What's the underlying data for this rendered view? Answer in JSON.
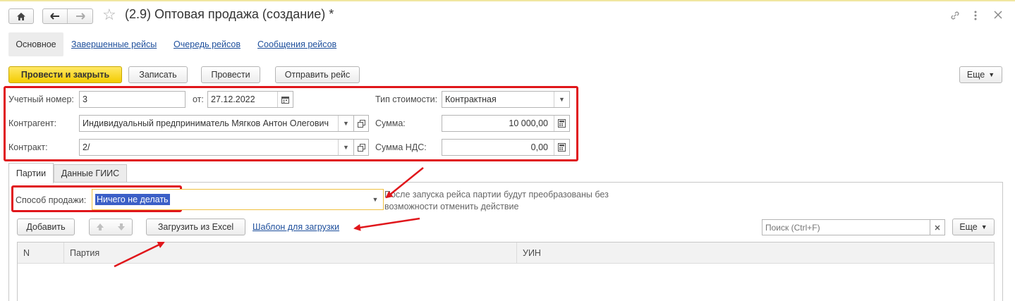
{
  "window": {
    "title": "(2.9) Оптовая продажа (создание) *",
    "icons": [
      "home-icon",
      "back-arrow-icon",
      "forward-arrow-icon",
      "star-icon",
      "link-icon",
      "more-vertical-icon",
      "close-icon"
    ]
  },
  "tabs": [
    {
      "label": "Основное",
      "active": true
    },
    {
      "label": "Завершенные рейсы"
    },
    {
      "label": "Очередь рейсов"
    },
    {
      "label": "Сообщения рейсов"
    }
  ],
  "toolbar": {
    "post_close": "Провести и закрыть",
    "save": "Записать",
    "post": "Провести",
    "send": "Отправить рейс",
    "more": "Еще"
  },
  "form": {
    "acc_number_label": "Учетный номер:",
    "acc_number": "3",
    "date_label": "от:",
    "date": "27.12.2022",
    "cost_type_label": "Тип стоимости:",
    "cost_type": "Контрактная",
    "contractor_label": "Контрагент:",
    "contractor": "Индивидуальный предприниматель Мягков Антон Олегович",
    "sum_label": "Сумма:",
    "sum": "10 000,00",
    "contract_label": "Контракт:",
    "contract": "2/",
    "vat_label": "Сумма НДС:",
    "vat": "0,00"
  },
  "subtabs": [
    {
      "label": "Партии",
      "active": true
    },
    {
      "label": "Данные ГИИС"
    }
  ],
  "sale": {
    "method_label": "Способ продажи:",
    "method_value": "Ничего не делать",
    "hint": "После запуска рейса партии будут преобразованы без возможности отменить действие"
  },
  "table_toolbar": {
    "add": "Добавить",
    "load_excel": "Загрузить из Excel",
    "template_link": "Шаблон для загрузки",
    "search_placeholder": "Поиск (Ctrl+F)",
    "more": "Еще"
  },
  "table": {
    "columns": [
      "N",
      "Партия",
      "УИН"
    ],
    "rows": []
  },
  "colors": {
    "primary_button": "#f3cc00",
    "annotation_red": "#e0161b",
    "link": "#1e4f9c",
    "selection": "#3b5fc7"
  }
}
